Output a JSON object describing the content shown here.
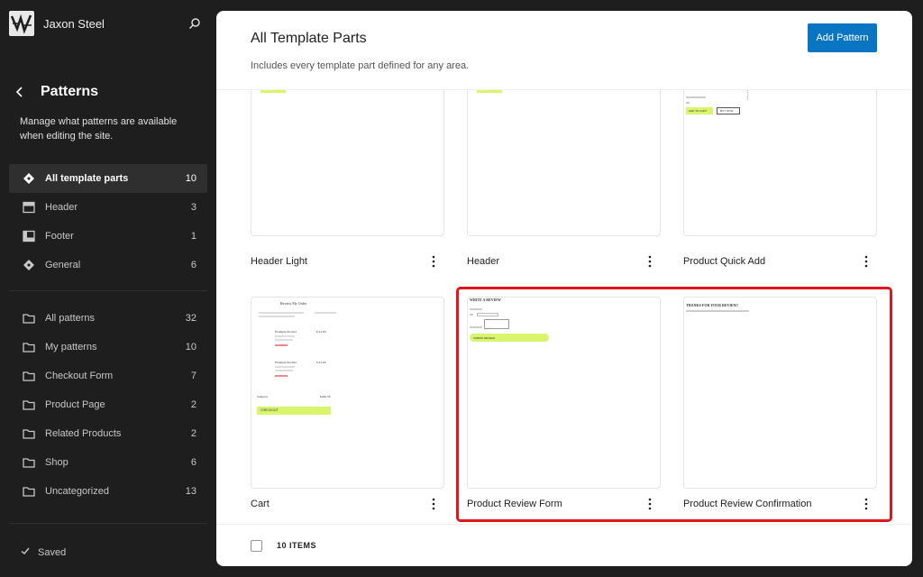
{
  "site": {
    "name": "Jaxon Steel",
    "logo_icon": "site-logo-icon"
  },
  "sidebar": {
    "title": "Patterns",
    "description": "Manage what patterns are available when editing the site.",
    "template_parts": [
      {
        "label": "All template parts",
        "count": "10",
        "icon": "symbol-filled-icon",
        "active": true
      },
      {
        "label": "Header",
        "count": "3",
        "icon": "header-icon"
      },
      {
        "label": "Footer",
        "count": "1",
        "icon": "footer-icon"
      },
      {
        "label": "General",
        "count": "6",
        "icon": "symbol-filled-icon"
      }
    ],
    "categories": [
      {
        "label": "All patterns",
        "count": "32",
        "icon": "folder-icon"
      },
      {
        "label": "My patterns",
        "count": "10",
        "icon": "folder-icon"
      },
      {
        "label": "Checkout Form",
        "count": "7",
        "icon": "folder-icon"
      },
      {
        "label": "Product Page",
        "count": "2",
        "icon": "folder-icon"
      },
      {
        "label": "Related Products",
        "count": "2",
        "icon": "folder-icon"
      },
      {
        "label": "Shop",
        "count": "6",
        "icon": "folder-icon"
      },
      {
        "label": "Uncategorized",
        "count": "13",
        "icon": "folder-icon"
      }
    ],
    "saved_label": "Saved"
  },
  "main": {
    "title": "All Template Parts",
    "subtitle": "Includes every template part defined for any area.",
    "add_button_label": "Add Pattern",
    "cards": [
      {
        "title": "Header Light"
      },
      {
        "title": "Header"
      },
      {
        "title": "Product Quick Add"
      },
      {
        "title": "Cart"
      },
      {
        "title": "Product Review Form"
      },
      {
        "title": "Product Review Confirmation"
      }
    ],
    "previews": {
      "quick_add_buttons": [
        "ADD TO CART",
        "BUY NOW"
      ],
      "cart_header": "Review My Order",
      "cart_checkout": "CHECKOUT",
      "cart_subtotal_label": "Subtotal",
      "cart_subtotal_value": "$246.78",
      "cart_item_name": "Example Product",
      "cart_item_price": "$ 41.00",
      "review_title": "WRITE A REVIEW",
      "review_submit": "SUBMIT REVIEW",
      "confirm_title": "THANKS FOR YOUR REVIEW!"
    },
    "footer": {
      "items_count": "10 ITEMS"
    }
  },
  "colors": {
    "accent": "#0a75c2",
    "highlight": "#e0161b",
    "lime": "#d9f56b"
  }
}
